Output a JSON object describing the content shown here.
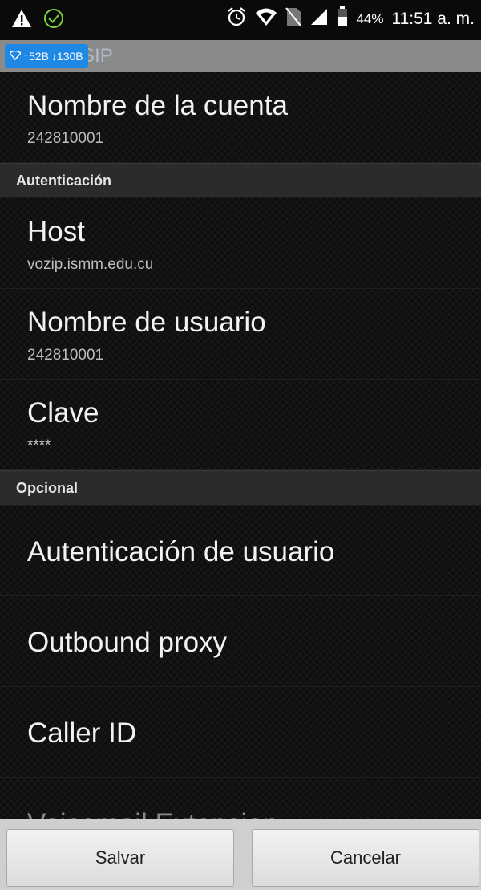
{
  "status_bar": {
    "battery_percent": "44%",
    "time": "11:51 a. m.",
    "icons": [
      "warning-icon",
      "check-circle-icon",
      "alarm-icon",
      "wifi-icon",
      "no-sim-icon",
      "signal-icon",
      "battery-icon"
    ]
  },
  "network_badge": {
    "upload": "↑52B",
    "download": "↓130B"
  },
  "header": {
    "title": "Cuenta SIP"
  },
  "account": {
    "name_title": "Nombre de la cuenta",
    "name_value": "242810001"
  },
  "auth_category": "Autenticación",
  "auth": {
    "host_title": "Host",
    "host_value": "vozip.ismm.edu.cu",
    "user_title": "Nombre de usuario",
    "user_value": "242810001",
    "pass_title": "Clave",
    "pass_value": "****"
  },
  "optional_category": "Opcional",
  "optional": {
    "user_auth": "Autenticación de usuario",
    "outbound_proxy": "Outbound proxy",
    "caller_id": "Caller ID",
    "voicemail": "Voicemail Extension"
  },
  "buttons": {
    "save": "Salvar",
    "cancel": "Cancelar"
  }
}
